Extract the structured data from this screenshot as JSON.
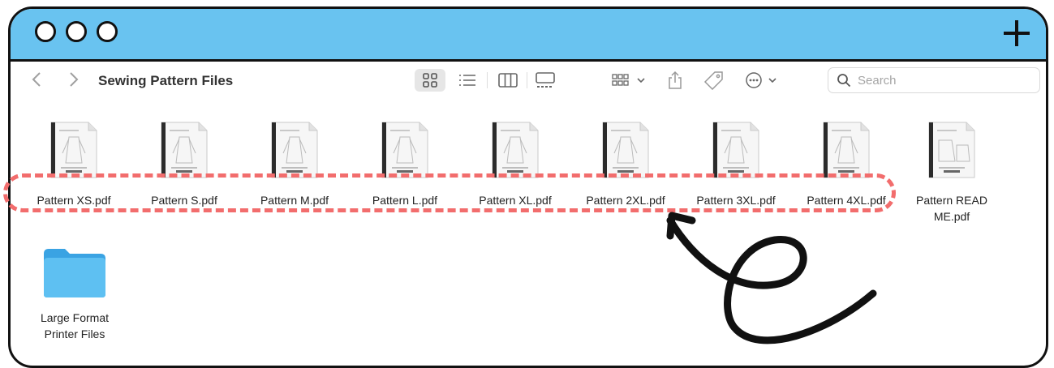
{
  "toolbar": {
    "title": "Sewing Pattern Files",
    "search_placeholder": "Search"
  },
  "icons": {
    "back": "chevron-left-icon",
    "forward": "chevron-right-icon",
    "grid_view": "grid-view-icon",
    "list_view": "list-view-icon",
    "column_view": "column-view-icon",
    "gallery_view": "gallery-view-icon",
    "group": "group-icon",
    "share": "share-icon",
    "tag": "tag-icon",
    "more": "more-icon",
    "search": "search-icon",
    "new_tab": "plus-icon"
  },
  "files": [
    {
      "name": "Pattern XS.pdf"
    },
    {
      "name": "Pattern S.pdf"
    },
    {
      "name": "Pattern M.pdf"
    },
    {
      "name": "Pattern L.pdf"
    },
    {
      "name": "Pattern XL.pdf"
    },
    {
      "name": "Pattern 2XL.pdf"
    },
    {
      "name": "Pattern 3XL.pdf"
    },
    {
      "name": "Pattern 4XL.pdf"
    },
    {
      "name": "Pattern READ ME.pdf"
    }
  ],
  "folders": [
    {
      "name": "Large Format Printer Files"
    }
  ],
  "colors": {
    "titlebar": "#69c3f0",
    "highlight": "#f26d6d",
    "folder": "#4fb2ea"
  }
}
